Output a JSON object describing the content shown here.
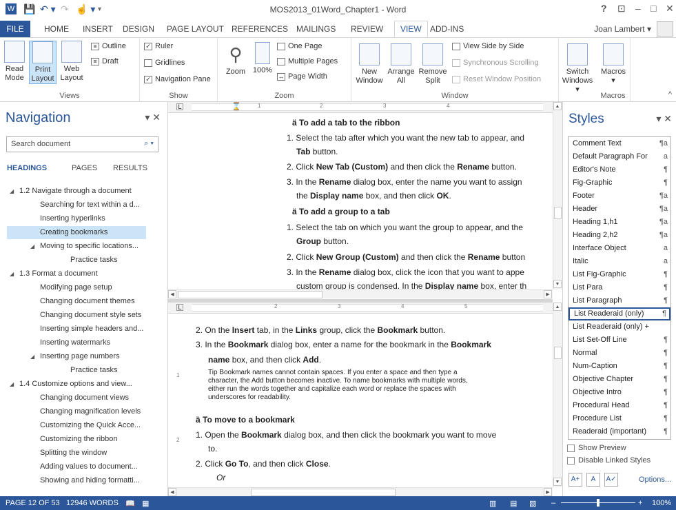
{
  "window": {
    "title": "MOS2013_01Word_Chapter1 - Word",
    "help": "?",
    "ribbon_display": "⊡",
    "minimize": "–",
    "restore": "□",
    "close": "✕"
  },
  "qat": {
    "app": "W",
    "save": "💾",
    "undo": "↶ ▾",
    "redo": "↷",
    "touch": "☝ ▾",
    "customize": "▾"
  },
  "tabs": {
    "file": "FILE",
    "items": [
      "HOME",
      "INSERT",
      "DESIGN",
      "PAGE LAYOUT",
      "REFERENCES",
      "MAILINGS",
      "REVIEW",
      "VIEW",
      "ADD-INS"
    ],
    "active": "VIEW",
    "user": "Joan Lambert ▾"
  },
  "ribbon": {
    "views": {
      "label": "Views",
      "read_mode": [
        "Read",
        "Mode"
      ],
      "print_layout": [
        "Print",
        "Layout"
      ],
      "web_layout": [
        "Web",
        "Layout"
      ],
      "outline": "Outline",
      "draft": "Draft"
    },
    "show": {
      "label": "Show",
      "ruler": "Ruler",
      "gridlines": "Gridlines",
      "navigation_pane": "Navigation Pane",
      "ruler_checked": true,
      "gridlines_checked": false,
      "navigation_checked": true
    },
    "zoom": {
      "label": "Zoom",
      "zoom": "Zoom",
      "hundred": "100%",
      "one_page": "One Page",
      "multiple_pages": "Multiple Pages",
      "page_width": "Page Width"
    },
    "window": {
      "label": "Window",
      "new_window": [
        "New",
        "Window"
      ],
      "arrange_all": [
        "Arrange",
        "All"
      ],
      "remove_split": [
        "Remove",
        "Split"
      ],
      "side_by_side": "View Side by Side",
      "sync_scrolling": "Synchronous Scrolling",
      "reset_position": "Reset Window Position"
    },
    "switch": {
      "label": [
        "Switch",
        "Windows ▾"
      ]
    },
    "macros": {
      "label": "Macros",
      "button": "Macros",
      "arrow": "▾"
    },
    "collapse": "^"
  },
  "nav": {
    "title": "Navigation",
    "close": "▾ ✕",
    "search_placeholder": "Search document",
    "search_icon": "⌕ ▾",
    "tabs": [
      "HEADINGS",
      "PAGES",
      "RESULTS"
    ],
    "items": [
      {
        "text": "1.2 Navigate through a document",
        "level": 1,
        "arrow": "◢"
      },
      {
        "text": "Searching for text within a d...",
        "level": 2
      },
      {
        "text": "Inserting hyperlinks",
        "level": 2
      },
      {
        "text": "Creating bookmarks",
        "level": 2,
        "selected": true
      },
      {
        "text": "Moving to specific locations...",
        "level": 2,
        "arrow": "◢"
      },
      {
        "text": "Practice tasks",
        "level": 3
      },
      {
        "text": "1.3 Format a document",
        "level": 1,
        "arrow": "◢"
      },
      {
        "text": "Modifying page setup",
        "level": 2
      },
      {
        "text": "Changing document themes",
        "level": 2
      },
      {
        "text": "Changing document style sets",
        "level": 2
      },
      {
        "text": "Inserting simple headers and...",
        "level": 2
      },
      {
        "text": "Inserting watermarks",
        "level": 2
      },
      {
        "text": "Inserting page numbers",
        "level": 2,
        "arrow": "◢"
      },
      {
        "text": "Practice tasks",
        "level": 3
      },
      {
        "text": "1.4 Customize options and view...",
        "level": 1,
        "arrow": "◢"
      },
      {
        "text": "Changing document views",
        "level": 2
      },
      {
        "text": "Changing magnification levels",
        "level": 2
      },
      {
        "text": "Customizing the Quick Acce...",
        "level": 2
      },
      {
        "text": "Customizing the ribbon",
        "level": 2
      },
      {
        "text": "Splitting the window",
        "level": 2
      },
      {
        "text": "Adding values to document...",
        "level": 2
      },
      {
        "text": "Showing and hiding formatti...",
        "level": 2
      }
    ]
  },
  "doc": {
    "ruler_marks": [
      "1",
      "2",
      "3",
      "4"
    ],
    "ruler2_marks": [
      "2",
      "3",
      "4",
      "5"
    ],
    "top": [
      {
        "html": "ä To add a tab to the ribbon",
        "bold": true
      },
      {
        "html": "1.  Select the tab after which you want the new tab to appear, and"
      },
      {
        "html": "<b>Tab</b> button."
      },
      {
        "html": "2.  Click <b>New Tab (Custom)</b> and then click the <b>Rename</b> button."
      },
      {
        "html": "3.  In the <b>Rename</b> dialog box, enter the name you want to assign"
      },
      {
        "html": "the <b>Display name</b> box, and then click <b>OK</b>."
      },
      {
        "html": "ä To add a group to a tab",
        "bold": true
      },
      {
        "html": "1.  Select the tab on which you want the group to appear, and the"
      },
      {
        "html": "<b>Group</b> button."
      },
      {
        "html": "2.  Click <b>New Group (Custom)</b> and then click the <b>Rename</b> button"
      },
      {
        "html": "3.  In the <b>Rename</b> dialog box, click the icon that you want to appe"
      },
      {
        "html": "custom group is condensed. In the <b>Display name</b> box, enter th"
      }
    ],
    "bottom": [
      {
        "html": "2.  On the <b>Insert</b> tab, in the <b>Links</b> group, click the <b>Bookmark</b> button."
      },
      {
        "html": "3.  In the <b>Bookmark</b> dialog box, enter a name for the bookmark in the <b>Bookmark</b>"
      },
      {
        "html": "<b>name</b> box, and then click <b>Add</b>."
      },
      {
        "html": "Tip  Bookmark names cannot contain spaces. If you enter a space and then type a"
      },
      {
        "html": "character, the Add button becomes inactive. To name bookmarks with multiple words,"
      },
      {
        "html": "either run the words together and capitalize each word or replace the spaces with"
      },
      {
        "html": "underscores for readability."
      },
      {
        "html": "ä To move to a bookmark",
        "bold": true
      },
      {
        "html": "1.  Open the <b>Bookmark</b> dialog box, and then click the bookmark you want to move"
      },
      {
        "html": "to."
      },
      {
        "html": "2.  Click <b>Go To</b>, and then click <b>Close</b>."
      },
      {
        "html": "<i>Or</i>"
      }
    ]
  },
  "styles": {
    "title": "Styles",
    "close": "▾ ✕",
    "items": [
      {
        "name": "Comment Text",
        "mark": "¶a"
      },
      {
        "name": "Default Paragraph For",
        "mark": "a"
      },
      {
        "name": "Editor's Note",
        "mark": "¶"
      },
      {
        "name": "Fig-Graphic",
        "mark": "¶"
      },
      {
        "name": "Footer",
        "mark": "¶a"
      },
      {
        "name": "Header",
        "mark": "¶a"
      },
      {
        "name": "Heading 1,h1",
        "mark": "¶a"
      },
      {
        "name": "Heading 2,h2",
        "mark": "¶a"
      },
      {
        "name": "Interface Object",
        "mark": "a"
      },
      {
        "name": "Italic",
        "mark": "a"
      },
      {
        "name": "List Fig-Graphic",
        "mark": "¶"
      },
      {
        "name": "List Para",
        "mark": "¶"
      },
      {
        "name": "List Paragraph",
        "mark": "¶"
      },
      {
        "name": "List Readeraid (only)",
        "mark": "¶",
        "selected": true
      },
      {
        "name": "List Readeraid (only) +",
        "mark": ""
      },
      {
        "name": "List Set-Off Line",
        "mark": "¶"
      },
      {
        "name": "Normal",
        "mark": "¶"
      },
      {
        "name": "Num-Caption",
        "mark": "¶"
      },
      {
        "name": "Objective Chapter",
        "mark": "¶"
      },
      {
        "name": "Objective Intro",
        "mark": "¶"
      },
      {
        "name": "Procedural Head",
        "mark": "¶"
      },
      {
        "name": "Procedure List",
        "mark": "¶"
      },
      {
        "name": "Readeraid (important)",
        "mark": "¶"
      }
    ],
    "show_preview": "Show Preview",
    "disable_linked": "Disable Linked Styles",
    "new_style": "A+",
    "inspector": "A",
    "manage": "A✓",
    "options": "Options..."
  },
  "status": {
    "page": "PAGE 12 OF 53",
    "words": "12946 WORDS",
    "proof_icon": "📖",
    "macro_icon": "▦",
    "view_read": "▥",
    "view_print": "▤",
    "view_web": "▧",
    "zoom_minus": "–",
    "zoom_plus": "+",
    "zoom": "100%"
  },
  "colors": {
    "accent": "#2b579a",
    "selection": "#cce4f7"
  }
}
